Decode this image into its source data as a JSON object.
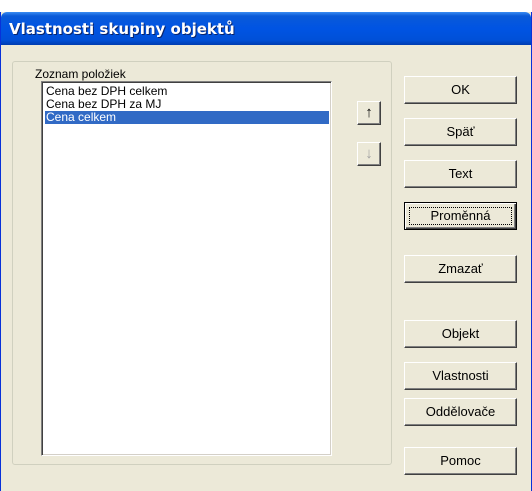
{
  "window": {
    "title": "Vlastnosti skupiny objektů"
  },
  "group": {
    "legend": "Zoznam položiek",
    "items": [
      {
        "label": "Cena bez  DPH celkem",
        "selected": false
      },
      {
        "label": "Cena bez DPH za MJ",
        "selected": false
      },
      {
        "label": "Cena celkem",
        "selected": true
      }
    ]
  },
  "arrows": {
    "up_icon": "arrow-up-icon",
    "down_icon": "arrow-down-icon",
    "up_glyph": "↑",
    "down_glyph": "↓"
  },
  "buttons": {
    "ok": "OK",
    "back": "Späť",
    "text": "Text",
    "variable": "Proměnná",
    "delete": "Zmazať",
    "object": "Objekt",
    "properties": "Vlastnosti",
    "separators": "Oddělovače",
    "help": "Pomoc"
  },
  "colors": {
    "titlebar": "#0054e3",
    "selection": "#316ac5",
    "dialog_bg": "#ece9d8"
  }
}
